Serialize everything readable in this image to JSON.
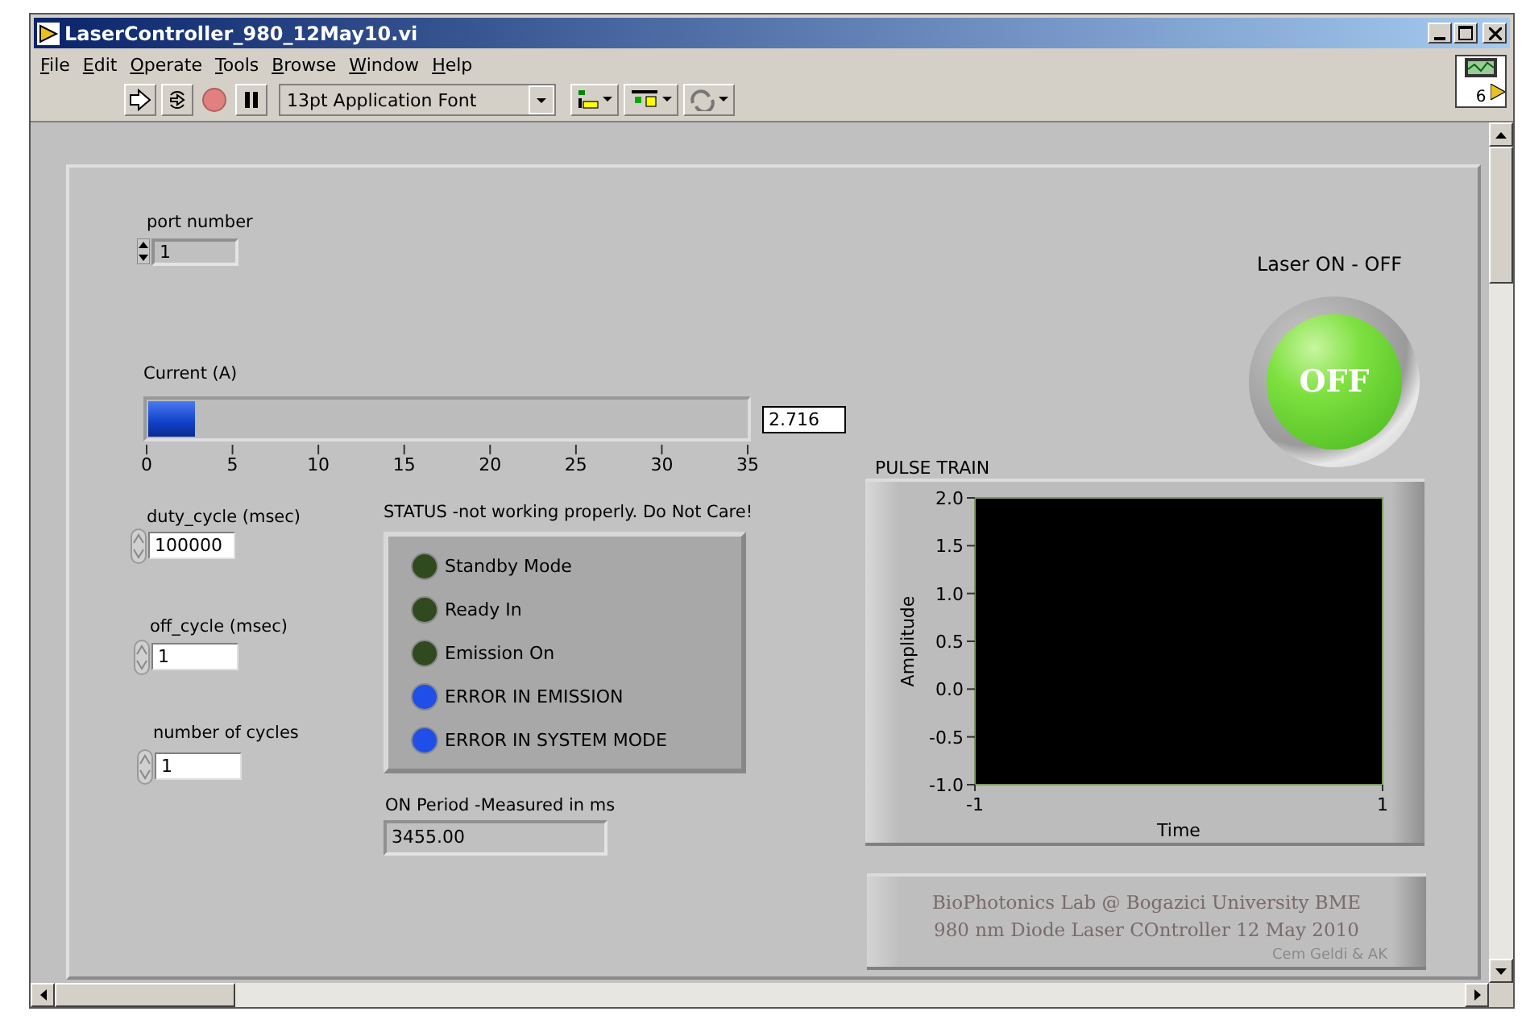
{
  "window": {
    "title": "LaserController_980_12May10.vi"
  },
  "menu": [
    "File",
    "Edit",
    "Operate",
    "Tools",
    "Browse",
    "Window",
    "Help"
  ],
  "toolbar": {
    "font": "13pt Application Font"
  },
  "connector_pane": {
    "label": "6"
  },
  "panel": {
    "port_number": {
      "label": "port number",
      "value": "1",
      "disabled": true
    },
    "current": {
      "label": "Current  (A)",
      "level": 0.078,
      "value": "2.716",
      "scale": [
        "0",
        "5",
        "10",
        "15",
        "20",
        "25",
        "30",
        "35"
      ]
    },
    "numerics": [
      {
        "label": "duty_cycle  (msec)",
        "value": "100000"
      },
      {
        "label": "off_cycle  (msec)",
        "value": "1"
      },
      {
        "label": "number of cycles",
        "value": "1"
      }
    ],
    "status": {
      "label": "STATUS -not working properly. Do Not Care!",
      "leds": [
        {
          "label": "Standby Mode",
          "color": "#2f4a1f"
        },
        {
          "label": "Ready In",
          "color": "#2f4a1f"
        },
        {
          "label": "Emission On",
          "color": "#2f4a1f"
        },
        {
          "label": "ERROR IN EMISSION",
          "color": "#1f4fe8"
        },
        {
          "label": "ERROR IN SYSTEM MODE",
          "color": "#1f4fe8"
        }
      ]
    },
    "on_period": {
      "label": "ON Period -Measured in ms",
      "value": "3455.00"
    },
    "laser": {
      "label": "Laser ON - OFF",
      "on": false,
      "button_text": "OFF"
    },
    "pulse_train": {
      "chart_data": {
        "type": "line",
        "title": "PULSE TRAIN",
        "xlabel": "Time",
        "ylabel": "Amplitude",
        "xlim": [
          -1,
          1
        ],
        "ylim": [
          -1,
          2
        ],
        "xticks": [
          -1,
          1
        ],
        "yticks": [
          {
            "value": 2,
            "label": "2.0"
          },
          {
            "value": 1.5,
            "label": "1.5"
          },
          {
            "value": 1,
            "label": "1.0"
          },
          {
            "value": 0.5,
            "label": "0.5"
          },
          {
            "value": 0,
            "label": "0.0"
          },
          {
            "value": -0.5,
            "label": "-0.5"
          },
          {
            "value": -1,
            "label": "-1.0"
          }
        ]
      }
    },
    "credits": {
      "lines": [
        "BioPhotonics Lab @ Bogazici University BME",
        "980 nm Diode Laser COntroller 12 May 2010"
      ],
      "author": "Cem Geldi & AK"
    }
  }
}
